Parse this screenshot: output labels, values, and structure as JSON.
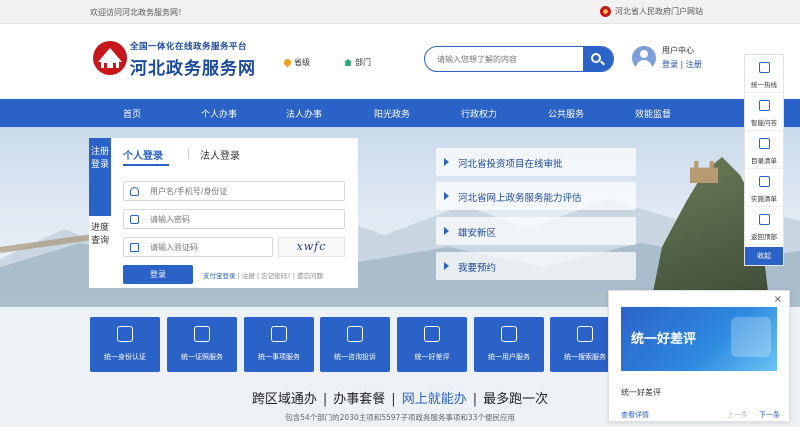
{
  "topbar": {
    "welcome": "欢迎访问河北政务服务网！",
    "gov_link": "河北省人民政府门户网站"
  },
  "header": {
    "logo_sub": "全国一体化在线政务服务平台",
    "logo_main": "河北政务服务网",
    "level": "省级",
    "dept": "部门",
    "search_placeholder": "请输入您想了解的内容",
    "user_center": "用户中心",
    "login": "登录",
    "register": "注册",
    "link_sep": "|"
  },
  "nav": [
    "首页",
    "个人办事",
    "法人办事",
    "阳光政务",
    "行政权力",
    "公共服务",
    "效能监督"
  ],
  "login": {
    "side_register": "注册登录",
    "side_progress": "进度查询",
    "tab_personal": "个人登录",
    "tab_legal": "法人登录",
    "user_placeholder": "用户名/手机号/身份证",
    "password_placeholder": "请输入密码",
    "code_placeholder": "请输入验证码",
    "captcha_text": "xwfc",
    "button": "登录",
    "alipay": "支付宝登录",
    "register": "注册",
    "forgot": "忘记密码?",
    "forgot_user": "遗忘问题"
  },
  "quick_links": [
    "河北省投资项目在线审批",
    "河北省网上政务服务能力评估",
    "雄安新区",
    "我要预约"
  ],
  "tiles": [
    "统一身份认证",
    "统一证照服务",
    "统一事项服务",
    "统一咨询投诉",
    "统一好差评",
    "统一用户服务",
    "统一搜索服务"
  ],
  "slogan": {
    "p1": "跨区域通办",
    "p2": "办事套餐",
    "p3": "网上就能办",
    "p4": "最多跑一次",
    "sep": "|",
    "sub": "包含54个部门的2030主项和5597子项政务服务事项和33个便民应用"
  },
  "right_bar": {
    "items": [
      "统一热线",
      "智能问答",
      "目录清单",
      "实施清单",
      "返回顶部"
    ],
    "collapse": "收起"
  },
  "popup": {
    "image_heading": "统一好差评",
    "title": "统一好差评",
    "details": "查看详情",
    "prev": "上一条",
    "next": "下一条",
    "close": "×"
  }
}
